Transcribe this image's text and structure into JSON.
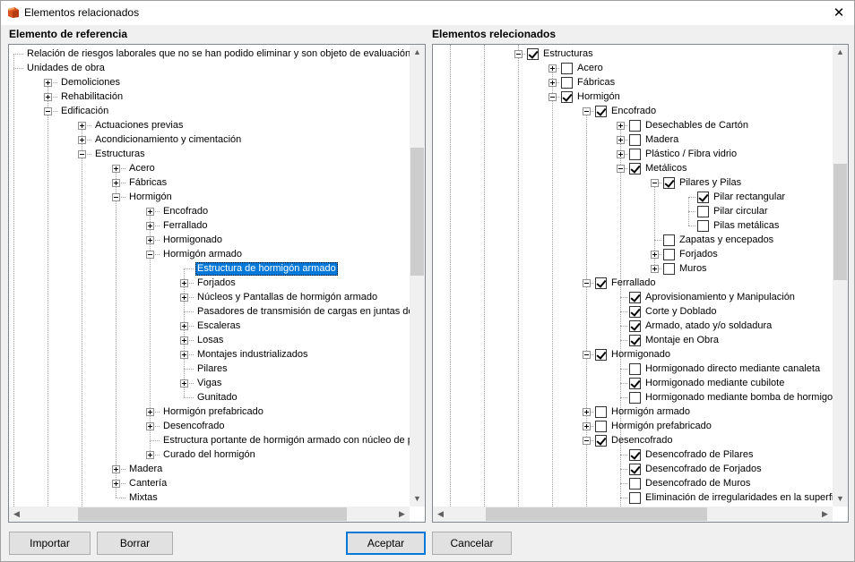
{
  "window": {
    "title": "Elementos relacionados",
    "close_glyph": "✕",
    "icon": "app-book-icon"
  },
  "left_panel": {
    "label": "Elemento de referencia",
    "rows": [
      {
        "text": "Relación de riesgos laborales que no se han podido eliminar y son objeto de evaluación",
        "level": 0,
        "exp": null
      },
      {
        "text": "Unidades de obra",
        "level": 0,
        "exp": null
      },
      {
        "text": "Demoliciones",
        "level": 1,
        "exp": "plus"
      },
      {
        "text": "Rehabilitación",
        "level": 1,
        "exp": "plus"
      },
      {
        "text": "Edificación",
        "level": 1,
        "exp": "minus"
      },
      {
        "text": "Actuaciones previas",
        "level": 2,
        "exp": "plus"
      },
      {
        "text": "Acondicionamiento y cimentación",
        "level": 2,
        "exp": "plus"
      },
      {
        "text": "Estructuras",
        "level": 2,
        "exp": "minus"
      },
      {
        "text": "Acero",
        "level": 3,
        "exp": "plus"
      },
      {
        "text": "Fábricas",
        "level": 3,
        "exp": "plus"
      },
      {
        "text": "Hormigón",
        "level": 3,
        "exp": "minus"
      },
      {
        "text": "Encofrado",
        "level": 4,
        "exp": "plus"
      },
      {
        "text": "Ferrallado",
        "level": 4,
        "exp": "plus"
      },
      {
        "text": "Hormigonado",
        "level": 4,
        "exp": "plus"
      },
      {
        "text": "Hormigón armado",
        "level": 4,
        "exp": "minus"
      },
      {
        "text": "Estructura de hormigón armado",
        "level": 5,
        "exp": null,
        "selected": true
      },
      {
        "text": "Forjados",
        "level": 5,
        "exp": "plus"
      },
      {
        "text": "Núcleos y Pantallas de hormigón armado",
        "level": 5,
        "exp": "plus"
      },
      {
        "text": "Pasadores de transmisión de cargas en juntas de di",
        "level": 5,
        "exp": null
      },
      {
        "text": "Escaleras",
        "level": 5,
        "exp": "plus"
      },
      {
        "text": "Losas",
        "level": 5,
        "exp": "plus"
      },
      {
        "text": "Montajes industrializados",
        "level": 5,
        "exp": "plus"
      },
      {
        "text": "Pilares",
        "level": 5,
        "exp": null
      },
      {
        "text": "Vigas",
        "level": 5,
        "exp": "plus"
      },
      {
        "text": "Gunitado",
        "level": 5,
        "exp": null
      },
      {
        "text": "Hormigón prefabricado",
        "level": 4,
        "exp": "plus"
      },
      {
        "text": "Desencofrado",
        "level": 4,
        "exp": "plus"
      },
      {
        "text": "Estructura portante de hormigón armado con núcleo de poli",
        "level": 4,
        "exp": null
      },
      {
        "text": "Curado del hormigón",
        "level": 4,
        "exp": "plus"
      },
      {
        "text": "Madera",
        "level": 3,
        "exp": "plus"
      },
      {
        "text": "Cantería",
        "level": 3,
        "exp": "plus"
      },
      {
        "text": "Mixtas",
        "level": 3,
        "exp": null
      }
    ]
  },
  "right_panel": {
    "label": "Elementos relecionados",
    "rows": [
      {
        "text": "Estructuras",
        "level": 0,
        "exp": "minus",
        "checked": true
      },
      {
        "text": "Acero",
        "level": 1,
        "exp": "plus",
        "checked": false
      },
      {
        "text": "Fábricas",
        "level": 1,
        "exp": "plus",
        "checked": false
      },
      {
        "text": "Hormigón",
        "level": 1,
        "exp": "minus",
        "checked": true
      },
      {
        "text": "Encofrado",
        "level": 2,
        "exp": "minus",
        "checked": true
      },
      {
        "text": "Desechables de Cartón",
        "level": 3,
        "exp": "plus",
        "checked": false
      },
      {
        "text": "Madera",
        "level": 3,
        "exp": "plus",
        "checked": false
      },
      {
        "text": "Plástico / Fibra vidrio",
        "level": 3,
        "exp": "plus",
        "checked": false
      },
      {
        "text": "Metálicos",
        "level": 3,
        "exp": "minus",
        "checked": true
      },
      {
        "text": "Pilares y Pilas",
        "level": 4,
        "exp": "minus",
        "checked": true
      },
      {
        "text": "Pilar rectangular",
        "level": 5,
        "exp": null,
        "checked": true
      },
      {
        "text": "Pilar circular",
        "level": 5,
        "exp": null,
        "checked": false
      },
      {
        "text": "Pilas metálicas",
        "level": 5,
        "exp": null,
        "checked": false
      },
      {
        "text": "Zapatas y encepados",
        "level": 4,
        "exp": null,
        "checked": false
      },
      {
        "text": "Forjados",
        "level": 4,
        "exp": "plus",
        "checked": false
      },
      {
        "text": "Muros",
        "level": 4,
        "exp": "plus",
        "checked": false
      },
      {
        "text": "Ferrallado",
        "level": 2,
        "exp": "minus",
        "checked": true
      },
      {
        "text": "Aprovisionamiento y Manipulación",
        "level": 3,
        "exp": null,
        "checked": true
      },
      {
        "text": "Corte y Doblado",
        "level": 3,
        "exp": null,
        "checked": true
      },
      {
        "text": "Armado, atado y/o soldadura",
        "level": 3,
        "exp": null,
        "checked": true
      },
      {
        "text": "Montaje en Obra",
        "level": 3,
        "exp": null,
        "checked": true
      },
      {
        "text": "Hormigonado",
        "level": 2,
        "exp": "minus",
        "checked": true
      },
      {
        "text": "Hormigonado directo mediante canaleta",
        "level": 3,
        "exp": null,
        "checked": false
      },
      {
        "text": "Hormigonado mediante cubilote",
        "level": 3,
        "exp": null,
        "checked": true
      },
      {
        "text": "Hormigonado mediante bomba de hormigo",
        "level": 3,
        "exp": null,
        "checked": false
      },
      {
        "text": "Hormigón armado",
        "level": 2,
        "exp": "plus",
        "checked": false
      },
      {
        "text": "Hormigón prefabricado",
        "level": 2,
        "exp": "plus",
        "checked": false
      },
      {
        "text": "Desencofrado",
        "level": 2,
        "exp": "minus",
        "checked": true
      },
      {
        "text": "Desencofrado de Pilares",
        "level": 3,
        "exp": null,
        "checked": true
      },
      {
        "text": "Desencofrado de Forjados",
        "level": 3,
        "exp": null,
        "checked": true
      },
      {
        "text": "Desencofrado de Muros",
        "level": 3,
        "exp": null,
        "checked": false
      },
      {
        "text": "Eliminación de irregularidades en la superfi",
        "level": 3,
        "exp": null,
        "checked": false
      }
    ]
  },
  "buttons": {
    "importar": "Importar",
    "borrar": "Borrar",
    "aceptar": "Aceptar",
    "cancelar": "Cancelar"
  },
  "scroll_glyphs": {
    "up": "▲",
    "down": "▼",
    "left": "◀",
    "right": "▶"
  }
}
